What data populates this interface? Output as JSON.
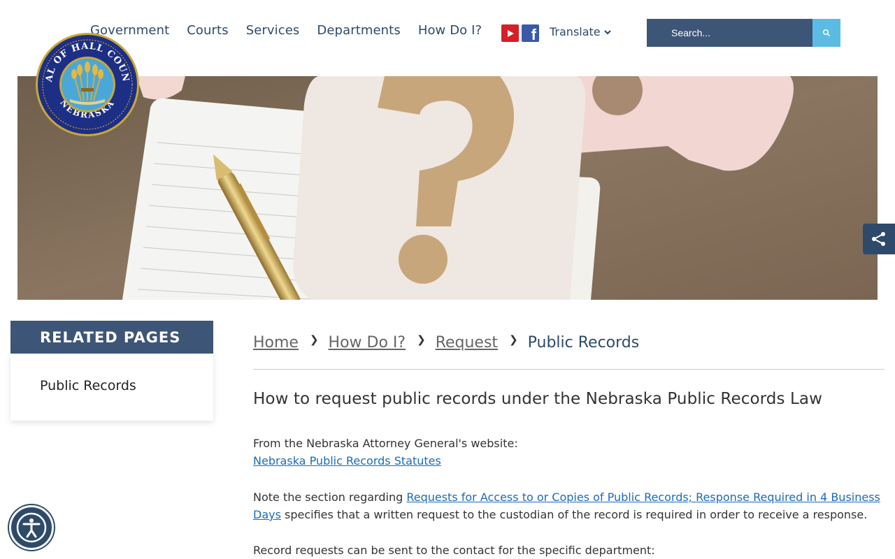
{
  "nav": {
    "items": [
      {
        "label": "Government"
      },
      {
        "label": "Courts"
      },
      {
        "label": "Services"
      },
      {
        "label": "Departments"
      },
      {
        "label": "How Do I?"
      }
    ]
  },
  "social": {
    "youtube_icon": "youtube-icon",
    "facebook_icon": "facebook-icon"
  },
  "translate": {
    "label": "Translate"
  },
  "search": {
    "placeholder": "Search..."
  },
  "seal": {
    "text": "SEAL OF HALL COUNTY NEBRASKA"
  },
  "related": {
    "heading": "RELATED PAGES",
    "items": [
      {
        "label": "Public Records"
      }
    ]
  },
  "breadcrumb": {
    "items": [
      "Home",
      "How Do I?",
      "Request"
    ],
    "current": "Public Records"
  },
  "content": {
    "title": "How to request public records under the Nebraska Public Records Law",
    "p1_text": "From the Nebraska Attorney General's website:",
    "p1_link": "Nebraska Public Records Statutes",
    "p2_pre": "Note the section regarding ",
    "p2_link": "Requests for Access to or Copies of Public Records; Response Required in 4 Business Days",
    "p2_post": " specifies that a written request to the custodian of the record is required in order to receive a response.",
    "p3_text": "Record requests can be sent to the contact for the specific department:"
  },
  "colors": {
    "navy": "#3d5577",
    "nav_text": "#2e4a6b",
    "search_button": "#5bbce3",
    "link": "#1a6bbd"
  }
}
